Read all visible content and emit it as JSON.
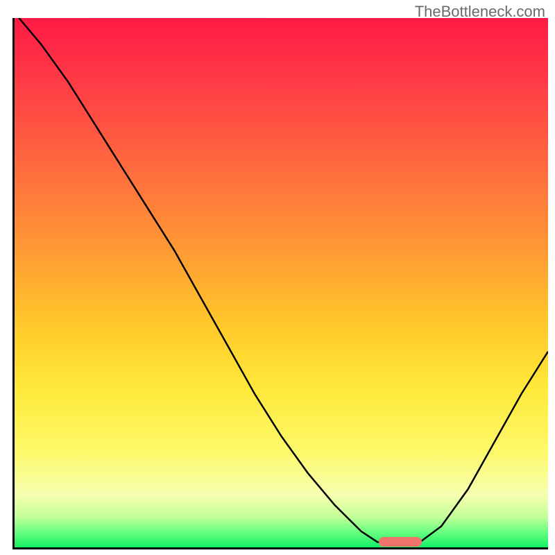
{
  "watermark": "TheBottleneck.com",
  "chart_data": {
    "type": "line",
    "title": "",
    "xlabel": "",
    "ylabel": "",
    "xlim": [
      0,
      100
    ],
    "ylim": [
      0,
      100
    ],
    "grid": false,
    "gradient_background": {
      "orientation": "vertical",
      "stops": [
        {
          "pos": 0.0,
          "color": "#ff1a44"
        },
        {
          "pos": 0.12,
          "color": "#ff3b46"
        },
        {
          "pos": 0.28,
          "color": "#ff6a3e"
        },
        {
          "pos": 0.44,
          "color": "#ff9a34"
        },
        {
          "pos": 0.58,
          "color": "#ffc92a"
        },
        {
          "pos": 0.7,
          "color": "#ffe93a"
        },
        {
          "pos": 0.82,
          "color": "#fdf96a"
        },
        {
          "pos": 0.9,
          "color": "#f6ffb0"
        },
        {
          "pos": 0.94,
          "color": "#c8ff9a"
        },
        {
          "pos": 0.97,
          "color": "#6cff82"
        },
        {
          "pos": 1.0,
          "color": "#13ef62"
        }
      ]
    },
    "series": [
      {
        "name": "bottleneck-curve",
        "color": "#000000",
        "x": [
          0,
          5,
          10,
          15,
          20,
          25,
          30,
          35,
          40,
          45,
          50,
          55,
          60,
          65,
          68,
          72,
          76,
          80,
          85,
          90,
          95,
          100
        ],
        "y": [
          101,
          95,
          88,
          80,
          72,
          64,
          56,
          47,
          38,
          29,
          21,
          14,
          8,
          3,
          1,
          0.5,
          1,
          4,
          11,
          20,
          29,
          37
        ]
      }
    ],
    "marker": {
      "name": "optimal-range",
      "x_range": [
        68,
        76
      ],
      "y": 0,
      "color": "#f0736c"
    }
  }
}
